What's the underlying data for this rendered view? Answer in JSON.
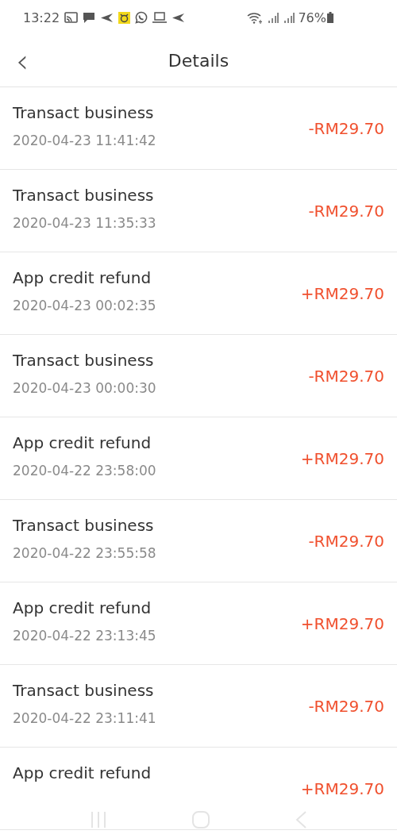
{
  "status_bar": {
    "time": "13:22",
    "battery": "76%"
  },
  "header": {
    "back_icon": "‹",
    "title": "Details"
  },
  "transactions": [
    {
      "title": "Transact business",
      "time": "2020-04-23 11:41:42",
      "amount": "-RM29.70"
    },
    {
      "title": "Transact business",
      "time": "2020-04-23 11:35:33",
      "amount": "-RM29.70"
    },
    {
      "title": "App credit refund",
      "time": "2020-04-23 00:02:35",
      "amount": "+RM29.70"
    },
    {
      "title": "Transact business",
      "time": "2020-04-23 00:00:30",
      "amount": "-RM29.70"
    },
    {
      "title": "App credit refund",
      "time": "2020-04-22 23:58:00",
      "amount": "+RM29.70"
    },
    {
      "title": "Transact business",
      "time": "2020-04-22 23:55:58",
      "amount": "-RM29.70"
    },
    {
      "title": "App credit refund",
      "time": "2020-04-22 23:13:45",
      "amount": "+RM29.70"
    },
    {
      "title": "Transact business",
      "time": "2020-04-22 23:11:41",
      "amount": "-RM29.70"
    },
    {
      "title": "App credit refund",
      "amount": "+RM29.70"
    }
  ]
}
